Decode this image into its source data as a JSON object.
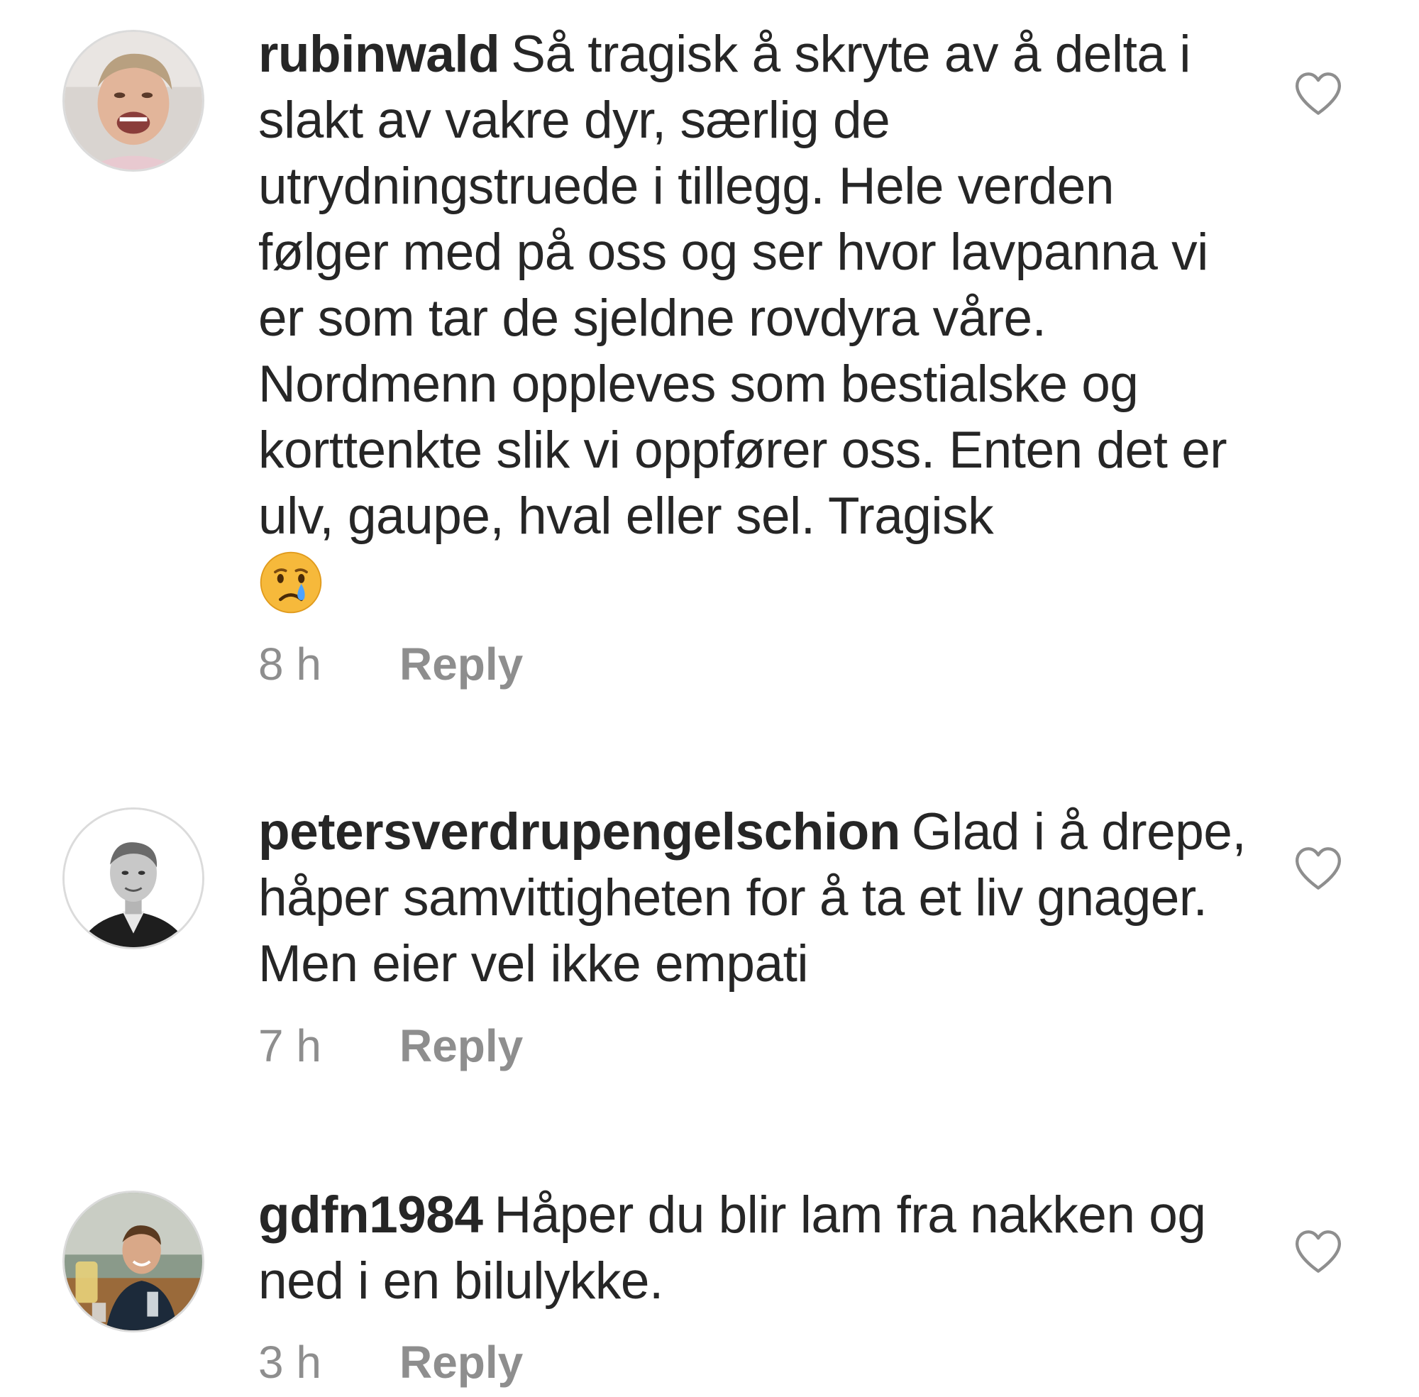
{
  "comments": [
    {
      "username": "rubinwald",
      "text": "Så tragisk å skryte av å delta i slakt av vakre dyr, særlig de utrydningstruede i tillegg. Hele verden følger med på oss og ser hvor lavpanna vi er som tar de sjeldne rovdyra våre. Nordmenn oppleves som bestialske og korttenkte slik vi oppfører oss. Enten det er ulv, gaupe, hval eller sel. Tragisk",
      "emoji": "crying-face-emoji",
      "time": "8 h",
      "reply_label": "Reply",
      "like_icon": "heart-outline-icon"
    },
    {
      "username": "petersverdrupengelschion",
      "text": "Glad i å drepe, håper samvittigheten for å ta et liv gnager. Men eier vel ikke empati",
      "time": "7 h",
      "reply_label": "Reply",
      "like_icon": "heart-outline-icon"
    },
    {
      "username": "gdfn1984",
      "text": "Håper du blir lam fra nakken og ned i en bilulykke.",
      "time": "3 h",
      "reply_label": "Reply",
      "like_icon": "heart-outline-icon"
    }
  ],
  "colors": {
    "text": "#262626",
    "meta": "#8e8e8e",
    "avatar_border": "#dbdbdb",
    "heart_stroke": "#8e8e8e"
  }
}
